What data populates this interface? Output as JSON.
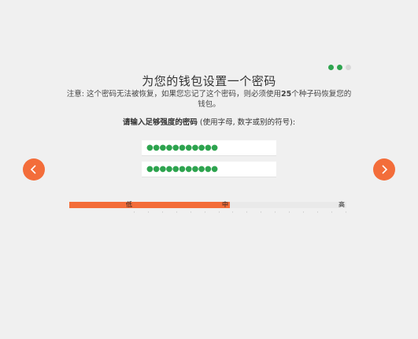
{
  "progress": {
    "steps_total": 3,
    "steps_completed": 2
  },
  "title": "为您的钱包设置一个密码",
  "note": {
    "prefix": "注意: 这个密码无法被恢复，如果您忘记了这个密码，则必须使用",
    "count": "25",
    "suffix": "个种子码恢复您的钱包。"
  },
  "prompt": {
    "bold": "请输入足够强度的密码",
    "rest": " (使用字母, 数字或别的符号):"
  },
  "password": {
    "value": "●●●●●●●●●●●",
    "confirm_value": "●●●●●●●●●●●"
  },
  "strength": {
    "level": 0.58,
    "low_label": "低",
    "mid_label": "中",
    "high_label": "高",
    "fill_color": "#f36d3a"
  },
  "nav": {
    "prev_icon": "chevron-left-icon",
    "next_icon": "chevron-right-icon",
    "button_color": "#f36d3a"
  },
  "accent": "#2ea44f"
}
